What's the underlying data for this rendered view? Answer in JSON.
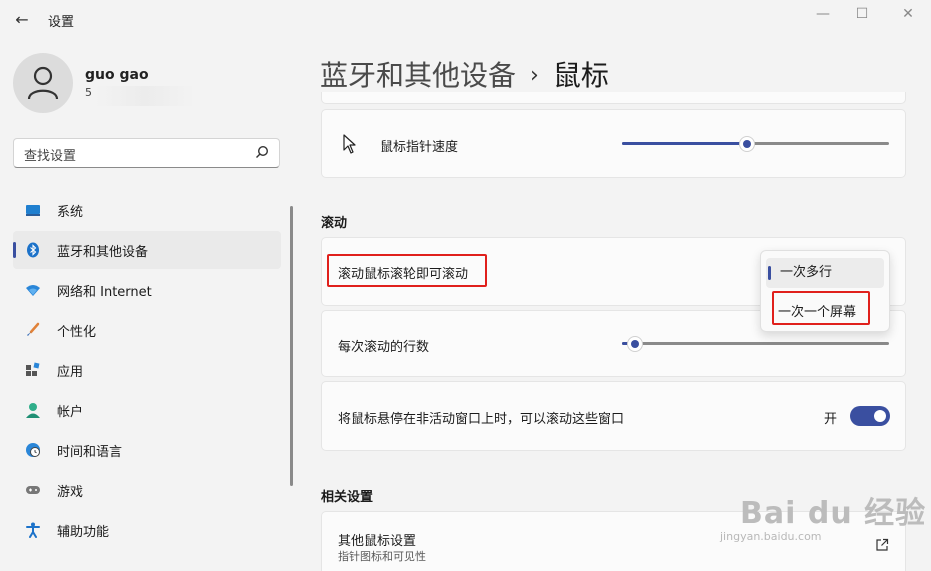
{
  "window": {
    "title": "设置",
    "back_icon": "←",
    "min_icon": "—",
    "max_icon": "☐",
    "close_icon": "✕"
  },
  "user": {
    "name": "guo gao",
    "account": "5"
  },
  "search": {
    "placeholder": "查找设置"
  },
  "nav": [
    {
      "label": "系统",
      "icon": "system-icon"
    },
    {
      "label": "蓝牙和其他设备",
      "icon": "bluetooth-icon",
      "active": true
    },
    {
      "label": "网络和 Internet",
      "icon": "wifi-icon"
    },
    {
      "label": "个性化",
      "icon": "brush-icon"
    },
    {
      "label": "应用",
      "icon": "apps-icon"
    },
    {
      "label": "帐户",
      "icon": "account-icon"
    },
    {
      "label": "时间和语言",
      "icon": "globe-clock-icon"
    },
    {
      "label": "游戏",
      "icon": "gamepad-icon"
    },
    {
      "label": "辅助功能",
      "icon": "accessibility-icon"
    }
  ],
  "breadcrumb": {
    "parent": "蓝牙和其他设备",
    "sep": "›",
    "current": "鼠标"
  },
  "pointer_speed": {
    "label": "鼠标指针速度",
    "value_fraction": 0.47
  },
  "scroll_section": {
    "title": "滚动",
    "scroll_mode": {
      "label": "滚动鼠标滚轮即可滚动",
      "options": [
        "一次多行",
        "一次一个屏幕"
      ],
      "selected": "一次多行"
    },
    "lines_per_scroll": {
      "label": "每次滚动的行数",
      "value_fraction": 0.05
    },
    "inactive_scroll": {
      "label": "将鼠标悬停在非活动窗口上时，可以滚动这些窗口",
      "state_label": "开",
      "on": true
    }
  },
  "related": {
    "title": "相关设置",
    "other_mouse": {
      "title": "其他鼠标设置",
      "subtitle": "指针图标和可见性"
    }
  },
  "watermark": {
    "brand": "Bai du 经验",
    "url": "jingyan.baidu.com"
  },
  "colors": {
    "accent": "#3a4fa0",
    "highlight_box": "#e0201c",
    "background": "#f3f3f3"
  }
}
